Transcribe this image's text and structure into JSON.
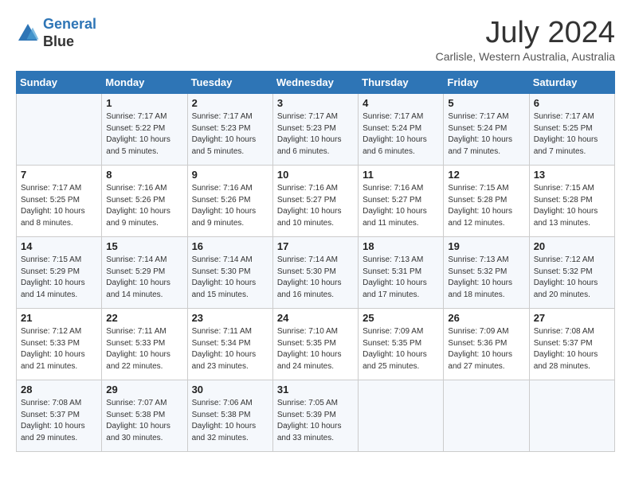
{
  "header": {
    "logo_line1": "General",
    "logo_line2": "Blue",
    "month_title": "July 2024",
    "location": "Carlisle, Western Australia, Australia"
  },
  "weekdays": [
    "Sunday",
    "Monday",
    "Tuesday",
    "Wednesday",
    "Thursday",
    "Friday",
    "Saturday"
  ],
  "weeks": [
    [
      {
        "day": "",
        "sunrise": "",
        "sunset": "",
        "daylight": ""
      },
      {
        "day": "1",
        "sunrise": "Sunrise: 7:17 AM",
        "sunset": "Sunset: 5:22 PM",
        "daylight": "Daylight: 10 hours and 5 minutes."
      },
      {
        "day": "2",
        "sunrise": "Sunrise: 7:17 AM",
        "sunset": "Sunset: 5:23 PM",
        "daylight": "Daylight: 10 hours and 5 minutes."
      },
      {
        "day": "3",
        "sunrise": "Sunrise: 7:17 AM",
        "sunset": "Sunset: 5:23 PM",
        "daylight": "Daylight: 10 hours and 6 minutes."
      },
      {
        "day": "4",
        "sunrise": "Sunrise: 7:17 AM",
        "sunset": "Sunset: 5:24 PM",
        "daylight": "Daylight: 10 hours and 6 minutes."
      },
      {
        "day": "5",
        "sunrise": "Sunrise: 7:17 AM",
        "sunset": "Sunset: 5:24 PM",
        "daylight": "Daylight: 10 hours and 7 minutes."
      },
      {
        "day": "6",
        "sunrise": "Sunrise: 7:17 AM",
        "sunset": "Sunset: 5:25 PM",
        "daylight": "Daylight: 10 hours and 7 minutes."
      }
    ],
    [
      {
        "day": "7",
        "sunrise": "Sunrise: 7:17 AM",
        "sunset": "Sunset: 5:25 PM",
        "daylight": "Daylight: 10 hours and 8 minutes."
      },
      {
        "day": "8",
        "sunrise": "Sunrise: 7:16 AM",
        "sunset": "Sunset: 5:26 PM",
        "daylight": "Daylight: 10 hours and 9 minutes."
      },
      {
        "day": "9",
        "sunrise": "Sunrise: 7:16 AM",
        "sunset": "Sunset: 5:26 PM",
        "daylight": "Daylight: 10 hours and 9 minutes."
      },
      {
        "day": "10",
        "sunrise": "Sunrise: 7:16 AM",
        "sunset": "Sunset: 5:27 PM",
        "daylight": "Daylight: 10 hours and 10 minutes."
      },
      {
        "day": "11",
        "sunrise": "Sunrise: 7:16 AM",
        "sunset": "Sunset: 5:27 PM",
        "daylight": "Daylight: 10 hours and 11 minutes."
      },
      {
        "day": "12",
        "sunrise": "Sunrise: 7:15 AM",
        "sunset": "Sunset: 5:28 PM",
        "daylight": "Daylight: 10 hours and 12 minutes."
      },
      {
        "day": "13",
        "sunrise": "Sunrise: 7:15 AM",
        "sunset": "Sunset: 5:28 PM",
        "daylight": "Daylight: 10 hours and 13 minutes."
      }
    ],
    [
      {
        "day": "14",
        "sunrise": "Sunrise: 7:15 AM",
        "sunset": "Sunset: 5:29 PM",
        "daylight": "Daylight: 10 hours and 14 minutes."
      },
      {
        "day": "15",
        "sunrise": "Sunrise: 7:14 AM",
        "sunset": "Sunset: 5:29 PM",
        "daylight": "Daylight: 10 hours and 14 minutes."
      },
      {
        "day": "16",
        "sunrise": "Sunrise: 7:14 AM",
        "sunset": "Sunset: 5:30 PM",
        "daylight": "Daylight: 10 hours and 15 minutes."
      },
      {
        "day": "17",
        "sunrise": "Sunrise: 7:14 AM",
        "sunset": "Sunset: 5:30 PM",
        "daylight": "Daylight: 10 hours and 16 minutes."
      },
      {
        "day": "18",
        "sunrise": "Sunrise: 7:13 AM",
        "sunset": "Sunset: 5:31 PM",
        "daylight": "Daylight: 10 hours and 17 minutes."
      },
      {
        "day": "19",
        "sunrise": "Sunrise: 7:13 AM",
        "sunset": "Sunset: 5:32 PM",
        "daylight": "Daylight: 10 hours and 18 minutes."
      },
      {
        "day": "20",
        "sunrise": "Sunrise: 7:12 AM",
        "sunset": "Sunset: 5:32 PM",
        "daylight": "Daylight: 10 hours and 20 minutes."
      }
    ],
    [
      {
        "day": "21",
        "sunrise": "Sunrise: 7:12 AM",
        "sunset": "Sunset: 5:33 PM",
        "daylight": "Daylight: 10 hours and 21 minutes."
      },
      {
        "day": "22",
        "sunrise": "Sunrise: 7:11 AM",
        "sunset": "Sunset: 5:33 PM",
        "daylight": "Daylight: 10 hours and 22 minutes."
      },
      {
        "day": "23",
        "sunrise": "Sunrise: 7:11 AM",
        "sunset": "Sunset: 5:34 PM",
        "daylight": "Daylight: 10 hours and 23 minutes."
      },
      {
        "day": "24",
        "sunrise": "Sunrise: 7:10 AM",
        "sunset": "Sunset: 5:35 PM",
        "daylight": "Daylight: 10 hours and 24 minutes."
      },
      {
        "day": "25",
        "sunrise": "Sunrise: 7:09 AM",
        "sunset": "Sunset: 5:35 PM",
        "daylight": "Daylight: 10 hours and 25 minutes."
      },
      {
        "day": "26",
        "sunrise": "Sunrise: 7:09 AM",
        "sunset": "Sunset: 5:36 PM",
        "daylight": "Daylight: 10 hours and 27 minutes."
      },
      {
        "day": "27",
        "sunrise": "Sunrise: 7:08 AM",
        "sunset": "Sunset: 5:37 PM",
        "daylight": "Daylight: 10 hours and 28 minutes."
      }
    ],
    [
      {
        "day": "28",
        "sunrise": "Sunrise: 7:08 AM",
        "sunset": "Sunset: 5:37 PM",
        "daylight": "Daylight: 10 hours and 29 minutes."
      },
      {
        "day": "29",
        "sunrise": "Sunrise: 7:07 AM",
        "sunset": "Sunset: 5:38 PM",
        "daylight": "Daylight: 10 hours and 30 minutes."
      },
      {
        "day": "30",
        "sunrise": "Sunrise: 7:06 AM",
        "sunset": "Sunset: 5:38 PM",
        "daylight": "Daylight: 10 hours and 32 minutes."
      },
      {
        "day": "31",
        "sunrise": "Sunrise: 7:05 AM",
        "sunset": "Sunset: 5:39 PM",
        "daylight": "Daylight: 10 hours and 33 minutes."
      },
      {
        "day": "",
        "sunrise": "",
        "sunset": "",
        "daylight": ""
      },
      {
        "day": "",
        "sunrise": "",
        "sunset": "",
        "daylight": ""
      },
      {
        "day": "",
        "sunrise": "",
        "sunset": "",
        "daylight": ""
      }
    ]
  ]
}
